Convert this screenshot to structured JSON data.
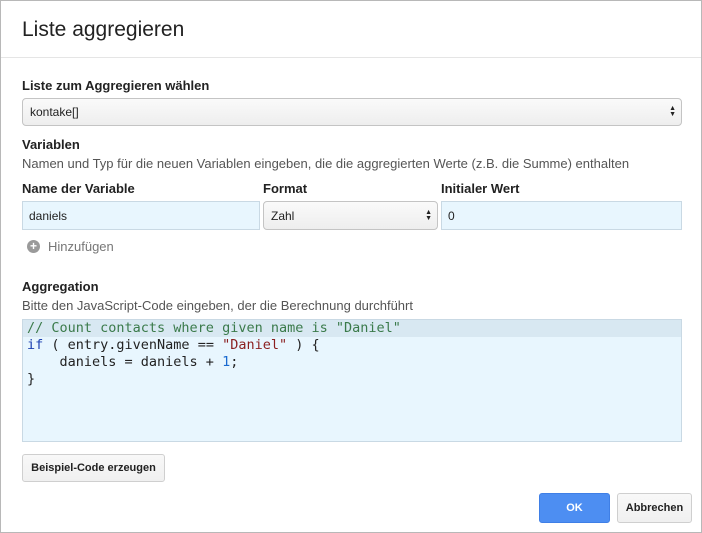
{
  "dialog": {
    "title": "Liste aggregieren",
    "list_section": {
      "label": "Liste zum Aggregieren wählen",
      "selected": "kontake[]"
    },
    "variables": {
      "heading": "Variablen",
      "hint": "Namen und Typ für die neuen Variablen eingeben, die die aggregierten Werte (z.B. die Summe) enthalten",
      "col_name": "Name der Variable",
      "col_format": "Format",
      "col_initial": "Initialer Wert",
      "row": {
        "name": "daniels",
        "format": "Zahl",
        "initial": "0"
      },
      "add_label": "Hinzufügen"
    },
    "aggregation": {
      "heading": "Aggregation",
      "hint": "Bitte den JavaScript-Code eingeben, der die Berechnung durchführt",
      "code": {
        "l1": "// Count contacts where given name is \"Daniel\"",
        "l2_kw": "if",
        "l2_a": " ( entry.givenName == ",
        "l2_str": "\"Daniel\"",
        "l2_b": " ) {",
        "l3_a": "    daniels = daniels + ",
        "l3_num": "1",
        "l3_b": ";",
        "l4": "}"
      }
    },
    "example_button": "Beispiel-Code erzeugen",
    "ok_button": "OK",
    "cancel_button": "Abbrechen"
  },
  "colors": {
    "accent": "#4d8ef2",
    "input_bg": "#e8f6fe"
  }
}
